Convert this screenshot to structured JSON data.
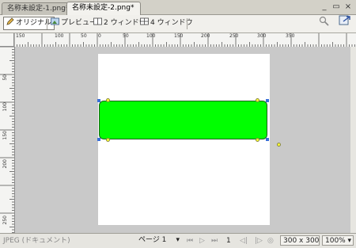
{
  "tabs": [
    {
      "label": "名称未設定-1.png*",
      "active": false
    },
    {
      "label": "名称未設定-2.png*",
      "active": true
    }
  ],
  "window_controls": {
    "minimize": "_",
    "restore": "▭",
    "close": "×"
  },
  "toolbar": {
    "original_label": "オリジナル",
    "preview_label": "プレビュー",
    "two_window_label": "2 ウィンドウ",
    "four_window_label": "4 ウィンドウ"
  },
  "rulers": {
    "h_ticks": [
      "150",
      "100",
      "50",
      "0",
      "50",
      "100",
      "150",
      "200",
      "250",
      "300",
      "350"
    ],
    "v_ticks": [
      "50",
      "100",
      "150",
      "200",
      "250"
    ]
  },
  "status": {
    "doc_type": "JPEG (ドキュメント)",
    "page_label": "ページ 1",
    "page_number": "1",
    "dimensions": "300 x 300",
    "zoom": "100%"
  },
  "colors": {
    "shape_fill": "#00ff00",
    "canvas_bg": "#c9c9c9",
    "document_bg": "#ffffff"
  }
}
